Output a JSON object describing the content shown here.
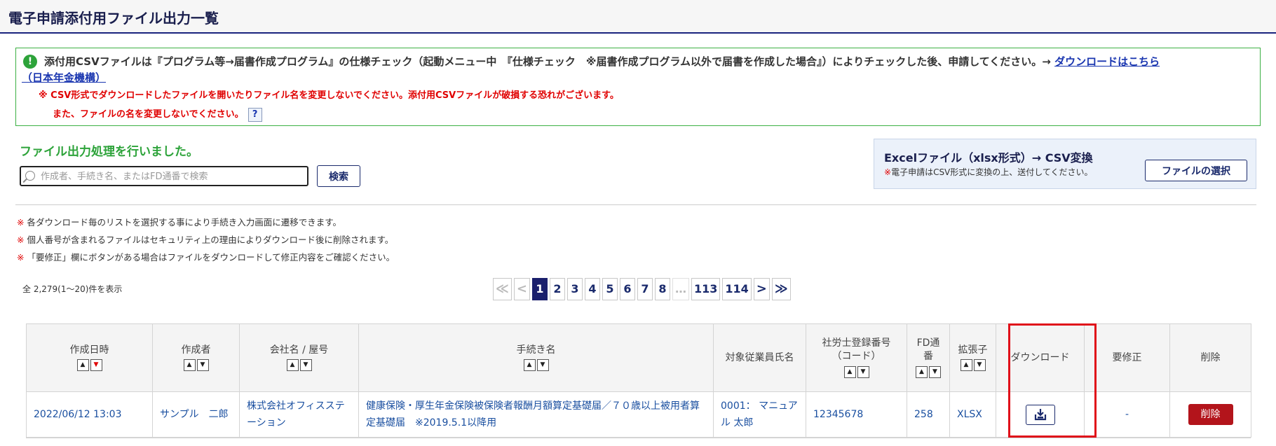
{
  "page": {
    "title": "電子申請添付用ファイル出力一覧"
  },
  "notice": {
    "line1_text": "添付用CSVファイルは『プログラム等→届書作成プログラム』の仕様チェック（起動メニュー中　『仕様チェック　※届書作成プログラム以外で届書を作成した場合』）によりチェックした後、申請してください。→ ",
    "link1": "ダウンロードはこちら",
    "link2": "（日本年金機構）",
    "warn1": "※ CSV形式でダウンロードしたファイルを開いたりファイル名を変更しないでください。添付用CSVファイルが破損する恐れがございます。",
    "warn2": "また、ファイルの名を変更しないでください。",
    "help_label": "?"
  },
  "done_message": "ファイル出力処理を行いました。",
  "search": {
    "placeholder": "作成者、手続き名、またはFD通番で検索",
    "value": "",
    "button": "検索"
  },
  "excel": {
    "title": "Excelファイル（xlsx形式）→ CSV変換",
    "note_mark": "※",
    "note": "電子申請はCSV形式に変換の上、送付してください。",
    "button": "ファイルの選択"
  },
  "notes": [
    {
      "mark": "※",
      "text": "各ダウンロード毎のリストを選択する事により手続き入力画面に遷移できます。"
    },
    {
      "mark": "※",
      "text": "個人番号が含まれるファイルはセキュリティ上の理由によりダウンロード後に削除されます。"
    },
    {
      "mark": "※",
      "text": "「要修正」欄にボタンがある場合はファイルをダウンロードして修正内容をご確認ください。"
    }
  ],
  "count_text": "全 2,279(1～20)件を表示",
  "pager": {
    "first": "≪",
    "prev": "<",
    "next": ">",
    "last": "≫",
    "ellipsis": "…",
    "pages": [
      "1",
      "2",
      "3",
      "4",
      "5",
      "6",
      "7",
      "8"
    ],
    "tail_pages": [
      "113",
      "114"
    ],
    "current": "1"
  },
  "table": {
    "headers": {
      "created": "作成日時",
      "author": "作成者",
      "company": "会社名 / 屋号",
      "procedure": "手続き名",
      "employee": "対象従業員氏名",
      "reg_no_1": "社労士登録番号",
      "reg_no_2": "（コード）",
      "fd_1": "FD通",
      "fd_2": "番",
      "ext": "拡張子",
      "download": "ダウンロード",
      "fix": "要修正",
      "delete": "削除"
    },
    "sort_up": "▲",
    "sort_down": "▼",
    "rows": [
      {
        "created": "2022/06/12 13:03",
        "author": "サンプル　二郎",
        "company": "株式会社オフィスステーション",
        "procedure": "健康保険・厚生年金保険被保険者報酬月額算定基礎届／７０歳以上被用者算定基礎届　※2019.5.1以降用",
        "employee": "0001： マニュアル 太郎",
        "reg_no": "12345678",
        "fd": "258",
        "ext": "XLSX",
        "fix": "-",
        "delete": "削除"
      }
    ]
  },
  "colors": {
    "header_border": "#1a237e",
    "success": "#2da33a",
    "warning": "#e00000",
    "link": "#1a4fa0",
    "delete": "#b3141b",
    "highlight": "#e0101a"
  }
}
